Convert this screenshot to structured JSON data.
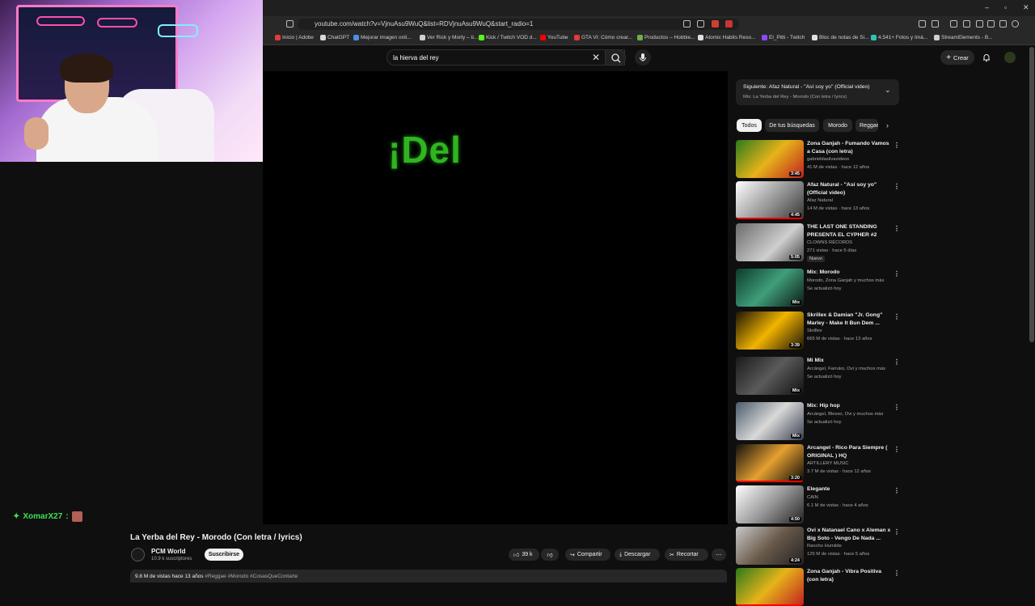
{
  "browser": {
    "url": "youtube.com/watch?v=VjnuAsu9WuQ&list=RDVjnuAsu9WuQ&start_radio=1",
    "bookmarks": [
      {
        "label": "Inicio | Adobe",
        "color": "#e03a3a"
      },
      {
        "label": "ChatGPT",
        "color": "#d9d9d9"
      },
      {
        "label": "Mejorar imagen onli...",
        "color": "#4a90e2"
      },
      {
        "label": "Ver Rick y Morty – ti...",
        "color": "#cfcfcf"
      },
      {
        "label": "Kick / Twitch VOD d...",
        "color": "#53fc18"
      },
      {
        "label": "YouTube",
        "color": "#ff0000"
      },
      {
        "label": "GTA VI: Cómo crear...",
        "color": "#e03a3a"
      },
      {
        "label": "Productos – Hobbie...",
        "color": "#6ab04c"
      },
      {
        "label": "Atomic Habits Reso...",
        "color": "#e0e0e0"
      },
      {
        "label": "El_Pitti - Twitch",
        "color": "#9146ff"
      },
      {
        "label": "Bloc de notas de Si...",
        "color": "#e0e0e0"
      },
      {
        "label": "4.541+ Fotos y Imá...",
        "color": "#2ec4b6"
      },
      {
        "label": "StreamElements - B...",
        "color": "#cfcfcf"
      }
    ]
  },
  "header": {
    "search_value": "la hierva del rey",
    "create_label": "Crear"
  },
  "player": {
    "lyric_text": "¡Del"
  },
  "chat": {
    "username": "XomarX27",
    "separator": ":"
  },
  "video": {
    "title": "La Yerba del Rey - Morodo (Con letra / lyrics)",
    "channel": "PCM World",
    "subscribers": "10.9 k suscriptores",
    "subscribe_label": "Suscribirse",
    "likes": "39 k",
    "share_label": "Compartir",
    "download_label": "Descargar",
    "clip_label": "Recortar",
    "views_date": "9.8 M de vistas  hace 13 años",
    "tags": "#Reggae #Morodo #CosasQueContarte"
  },
  "sidebar": {
    "next_title": "Siguiente: Afaz Natural - \"Así soy yo\" (Official video)",
    "next_sub": "Mix: La Yerba del Rey - Morodo (Con letra / lyrics)",
    "chips": [
      "Todos",
      "De tus búsquedas",
      "Morodo",
      "Reggae"
    ],
    "items": [
      {
        "title": "Zona Ganjah - Fumando Vamos a Casa (con letra)",
        "meta1": "gabrieldasilvavideos",
        "meta2": "41 M de vistas · hace 12 años",
        "duration": "3:45",
        "progress": 0.0
      },
      {
        "title": "Afaz Natural - \"Así soy yo\" (Official video)",
        "meta1": "Afaz Natural",
        "meta2": "14 M de vistas · hace 13 años",
        "duration": "4:45",
        "progress": 1.0
      },
      {
        "title": "THE LAST ONE STANDING PRESENTA EL CYPHER #2",
        "meta1": "CLOWNS RÉCORDS",
        "meta2": "271 vistas · hace 5 días",
        "duration": "5:05",
        "badge": "Nuevo",
        "progress": 0.0
      },
      {
        "title": "Mix: Morodo",
        "meta1": "Morodo, Zona Ganjah y muchos más",
        "meta2": "Se actualizó hoy",
        "duration": "Mix",
        "progress": 0.0
      },
      {
        "title": "Skrillex & Damian \"Jr. Gong\" Marley - Make It Bun Dem ...",
        "meta1": "Skrillex",
        "meta2": "665 M de vistas · hace 13 años",
        "duration": "3:39",
        "progress": 0.0
      },
      {
        "title": "Mi Mix",
        "meta1": "Arcángel, Farruko, Ovi y muchos más",
        "meta2": "Se actualizó hoy",
        "duration": "Mix",
        "progress": 0.0
      },
      {
        "title": "Mix: Hip hop",
        "meta1": "Arcángel, Blesso, Ovi y muchos más",
        "meta2": "Se actualizó hoy",
        "duration": "Mix",
        "progress": 0.0
      },
      {
        "title": "Arcangel - Rico Para Siempre ( ORIGINAL ) HQ",
        "meta1": "ARTILLERY MUSIC",
        "meta2": "3.7 M de vistas · hace 12 años",
        "duration": "3:20",
        "progress": 1.0
      },
      {
        "title": "Elegante",
        "meta1": "CAIN",
        "meta2": "6.1 M de vistas · hace 4 años",
        "duration": "4:50",
        "progress": 0.0
      },
      {
        "title": "Ovi x Natanael Cano x Aleman x Big Soto - Vengo De Nada ...",
        "meta1": "Rancho Humilde",
        "meta2": "125 M de vistas · hace 5 años",
        "duration": "4:24",
        "progress": 0.0
      },
      {
        "title": "Zona Ganjah - Vibra Positiva (con letra)",
        "meta1": "",
        "meta2": "",
        "duration": "",
        "progress": 1.0
      }
    ]
  },
  "colors": {
    "background": "#0f0f0f",
    "lyric_green": "#2fb51f",
    "chat_green": "#3ee05a",
    "progress_red": "#ff0000"
  },
  "icons": [
    "close-icon",
    "search-icon",
    "mic-icon",
    "plus-icon",
    "bell-icon",
    "like-icon",
    "dislike-icon",
    "share-icon",
    "download-icon",
    "scissors-icon",
    "more-icon",
    "chevron-down-icon",
    "chevron-right-icon",
    "verified-icon"
  ]
}
